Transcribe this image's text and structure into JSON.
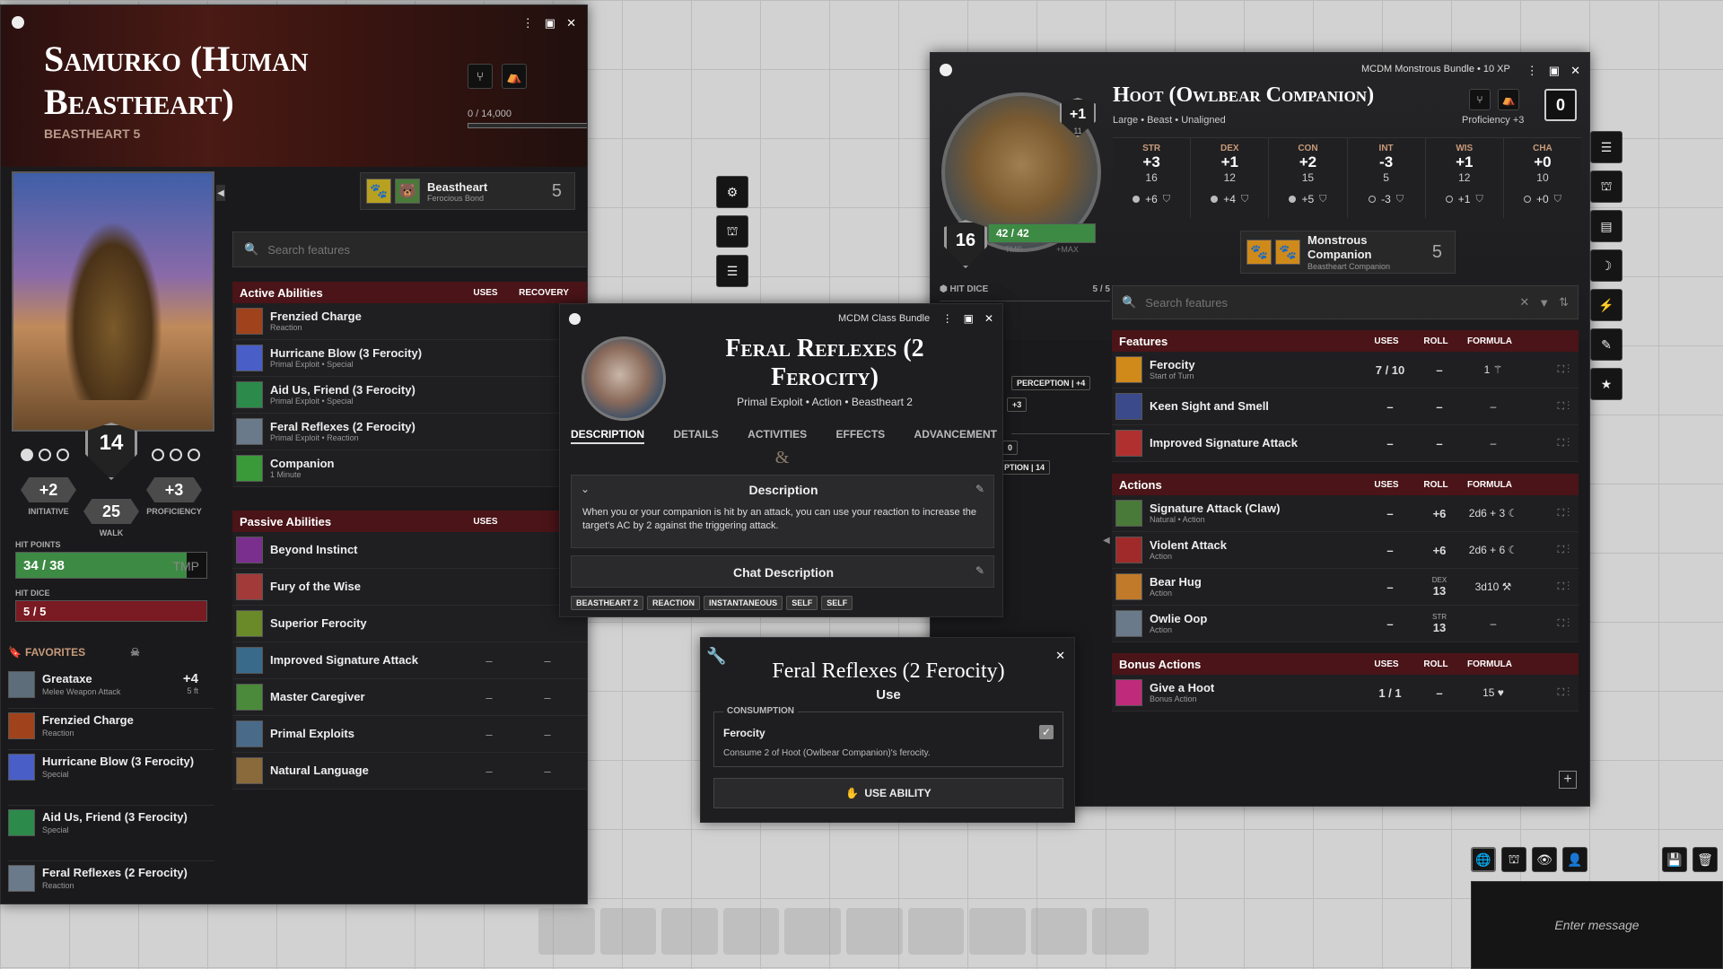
{
  "left_sheet": {
    "name": "Samurko (Human Beastheart)",
    "subtitle": "BEASTHEART 5",
    "level": "5",
    "xp": "0 / 14,000",
    "ac": "14",
    "initiative": "+2",
    "initiative_label": "INITIATIVE",
    "proficiency": "+3",
    "proficiency_label": "PROFICIENCY",
    "speed": "25",
    "speed_label": "WALK",
    "hp_label": "HIT POINTS",
    "hp": "34 / 38",
    "hp_fraction": 0.895,
    "tmp": "TMP",
    "hd_label": "HIT DICE",
    "hd": "5 / 5",
    "class_name": "Beastheart",
    "class_sub": "Ferocious Bond",
    "class_level": "5",
    "search_placeholder": "Search features",
    "favorites_label": "FAVORITES",
    "favorites": [
      {
        "name": "Greataxe",
        "sub": "Melee Weapon Attack",
        "bonus": "+4",
        "range": "5 ft",
        "icon": "axe-icon",
        "color": "#5d6d7a"
      },
      {
        "name": "Frenzied Charge",
        "sub": "Reaction",
        "bonus": "",
        "range": "",
        "icon": "charge-icon",
        "color": "#a0431d"
      },
      {
        "name": "Hurricane Blow (3 Ferocity)",
        "sub": "Special",
        "bonus": "",
        "range": "",
        "icon": "wind-icon",
        "color": "#4a5ec7"
      },
      {
        "name": "Aid Us, Friend (3 Ferocity)",
        "sub": "Special",
        "bonus": "",
        "range": "",
        "icon": "aid-icon",
        "color": "#2c8a4a"
      },
      {
        "name": "Feral Reflexes (2 Ferocity)",
        "sub": "Reaction",
        "bonus": "",
        "range": "",
        "icon": "reflex-icon",
        "color": "#6b7a8a"
      }
    ],
    "active_header": "Active Abilities",
    "active_cols": [
      "USES",
      "RECOVERY"
    ],
    "active": [
      {
        "name": "Frenzied Charge",
        "sub": "Reaction",
        "color": "#a0431d"
      },
      {
        "name": "Hurricane Blow (3 Ferocity)",
        "sub": "Primal Exploit • Special",
        "color": "#4a5ec7"
      },
      {
        "name": "Aid Us, Friend (3 Ferocity)",
        "sub": "Primal Exploit • Special",
        "color": "#2c8a4a"
      },
      {
        "name": "Feral Reflexes (2 Ferocity)",
        "sub": "Primal Exploit • Reaction",
        "color": "#6b7a8a"
      },
      {
        "name": "Companion",
        "sub": "1 Minute",
        "color": "#3a9a3a"
      }
    ],
    "passive_header": "Passive Abilities",
    "passive_cols": [
      "USES"
    ],
    "passive": [
      {
        "name": "Beyond Instinct",
        "uses": "",
        "rec": "",
        "color": "#7a2f8f"
      },
      {
        "name": "Fury of the Wise",
        "uses": "",
        "rec": "",
        "color": "#a23a3a"
      },
      {
        "name": "Superior Ferocity",
        "uses": "",
        "rec": "",
        "color": "#6a8a2a"
      },
      {
        "name": "Improved Signature Attack",
        "uses": "–",
        "rec": "–",
        "color": "#3a6a8a"
      },
      {
        "name": "Master Caregiver",
        "uses": "–",
        "rec": "–",
        "color": "#4a8a3a"
      },
      {
        "name": "Primal Exploits",
        "uses": "–",
        "rec": "–",
        "color": "#4a6a8a"
      },
      {
        "name": "Natural Language",
        "uses": "–",
        "rec": "–",
        "color": "#8a6a3a"
      }
    ]
  },
  "right_sheet": {
    "bundle": "MCDM Monstrous Bundle • 10 XP",
    "name": "Hoot (Owlbear Companion)",
    "subtitle": "Large • Beast • Unaligned",
    "proficiency": "Proficiency +3",
    "ferocity_box": "0",
    "cr": "+1",
    "cr_sub": "11",
    "ac": "16",
    "hp": "42 / 42",
    "hp_fraction": 1.0,
    "tmp": "TMP",
    "max": "+MAX",
    "hit_dice_label": "HIT DICE",
    "hit_dice": "5 / 5",
    "perception": "PERCEPTION | +4",
    "plus3": "+3",
    "zero": "0",
    "ption": "PTION | 14",
    "abilities": [
      {
        "label": "STR",
        "mod": "+3",
        "score": "16",
        "save": "+6"
      },
      {
        "label": "DEX",
        "mod": "+1",
        "score": "12",
        "save": "+4"
      },
      {
        "label": "CON",
        "mod": "+2",
        "score": "15",
        "save": "+5"
      },
      {
        "label": "INT",
        "mod": "-3",
        "score": "5",
        "save": "-3"
      },
      {
        "label": "WIS",
        "mod": "+1",
        "score": "12",
        "save": "+1"
      },
      {
        "label": "CHA",
        "mod": "+0",
        "score": "10",
        "save": "+0"
      }
    ],
    "class_name": "Monstrous Companion",
    "class_sub": "Beastheart Companion",
    "class_level": "5",
    "search_placeholder": "Search features",
    "features_header": "Features",
    "cols": [
      "USES",
      "ROLL",
      "FORMULA"
    ],
    "features": [
      {
        "name": "Ferocity",
        "sub": "Start of Turn",
        "uses": "7 / 10",
        "roll": "–",
        "formula": "1 ⚚",
        "color": "#d08a1a"
      },
      {
        "name": "Keen Sight and Smell",
        "sub": "",
        "uses": "–",
        "roll": "–",
        "formula": "–",
        "color": "#3a4a8a"
      },
      {
        "name": "Improved Signature Attack",
        "sub": "",
        "uses": "–",
        "roll": "–",
        "formula": "–",
        "color": "#b03030"
      }
    ],
    "actions_header": "Actions",
    "actions": [
      {
        "name": "Signature Attack (Claw)",
        "sub": "Natural • Action",
        "uses": "–",
        "roll": "+6",
        "roll_top": "",
        "formula": "2d6 + 3 ☾",
        "color": "#4a7a3a"
      },
      {
        "name": "Violent Attack",
        "sub": "Action",
        "uses": "–",
        "roll": "+6",
        "roll_top": "",
        "formula": "2d6 + 6 ☾",
        "color": "#a02a2a"
      },
      {
        "name": "Bear Hug",
        "sub": "Action",
        "uses": "–",
        "roll": "13",
        "roll_top": "DEX",
        "formula": "3d10 ⚒",
        "color": "#c07a2a"
      },
      {
        "name": "Owlie Oop",
        "sub": "Action",
        "uses": "–",
        "roll": "13",
        "roll_top": "STR",
        "formula": "–",
        "color": "#6a7a8a"
      }
    ],
    "bonus_header": "Bonus Actions",
    "bonus": [
      {
        "name": "Give a Hoot",
        "sub": "Bonus Action",
        "uses": "1 / 1",
        "roll": "–",
        "formula": "15 ♥",
        "color": "#c02a7a"
      }
    ]
  },
  "item_dialog": {
    "bundle": "MCDM Class Bundle",
    "title": "Feral Reflexes (2 Ferocity)",
    "subtitle": "Primal Exploit • Action • Beastheart 2",
    "tabs": [
      "DESCRIPTION",
      "DETAILS",
      "ACTIVITIES",
      "EFFECTS",
      "ADVANCEMENT"
    ],
    "desc_header": "Description",
    "desc_text": "When you or your companion is hit by an attack, you can use your reaction to increase the target's AC by 2 against the triggering attack.",
    "chat_header": "Chat Description",
    "tags": [
      "BEASTHEART 2",
      "REACTION",
      "INSTANTANEOUS",
      "SELF",
      "SELF"
    ]
  },
  "use_dialog": {
    "title": "Feral Reflexes (2 Ferocity)",
    "subtitle": "Use",
    "consumption_label": "CONSUMPTION",
    "resource": "Ferocity",
    "note": "Consume 2 of Hoot (Owlbear Companion)'s ferocity.",
    "button": "USE ABILITY"
  },
  "chat": {
    "placeholder": "Enter message"
  }
}
